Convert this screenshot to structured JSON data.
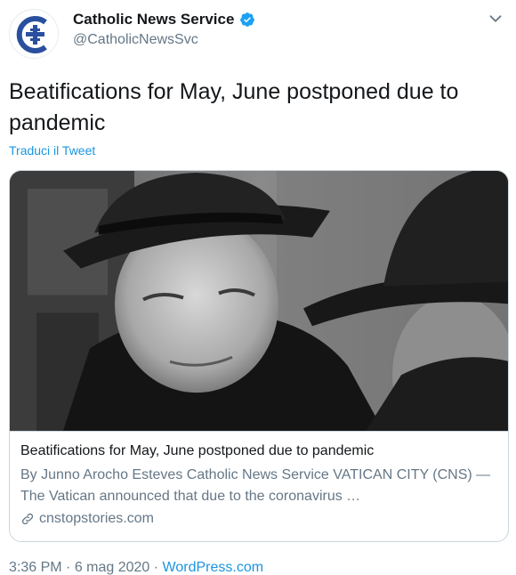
{
  "author": {
    "display_name": "Catholic News Service",
    "handle": "@CatholicNewsSvc",
    "verified": true,
    "brand_color": "#2a4f9e"
  },
  "tweet": {
    "text": "Beatifications for May, June postponed due to pandemic",
    "translate_label": "Traduci il Tweet"
  },
  "card": {
    "title": "Beatifications for May, June postponed due to pandemic",
    "description": "By Junno Arocho Esteves  Catholic News Service VATICAN CITY (CNS) — The Vatican announced that due to the coronavirus …",
    "domain": "cnstopstories.com",
    "link_icon": "link-icon",
    "image_alt_icon": "photo"
  },
  "meta": {
    "time": "3:36 PM",
    "separator": " · ",
    "date": "6 mag 2020",
    "source": "WordPress.com"
  },
  "colors": {
    "link": "#1b95e0",
    "secondary_text": "#657786",
    "border": "#ccd6dd"
  }
}
